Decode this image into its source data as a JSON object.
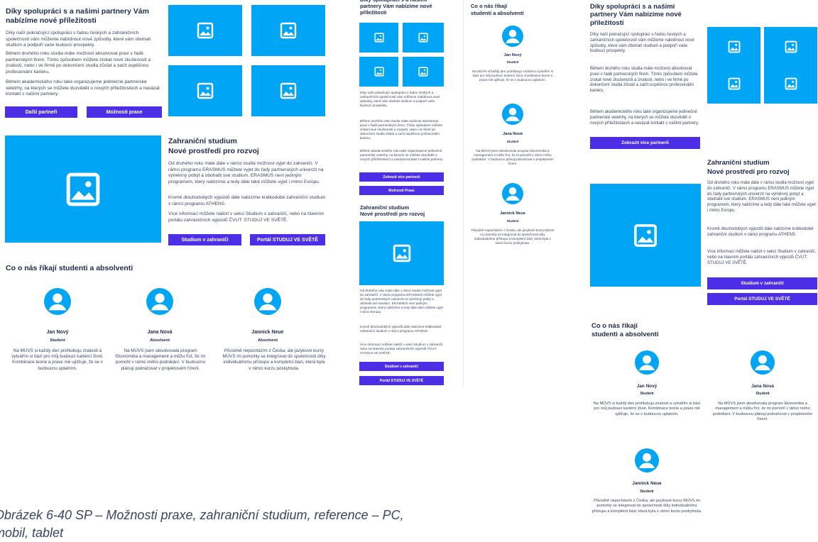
{
  "partners": {
    "title": "Díky spolupráci s a našimi partnery Vám nabízíme nové příležitosti",
    "p1": "Díky naší pokračující spolupráci s řadou českých a zahraničních společností vám můžeme nabídnout nové způsoby, které vám obohatí studium a podpoří vaše budoucí prospekty.",
    "p2": "Během druhého roku studia máte možnost absolvovat praxi v řadě partnerských firem. Tímto způsobem můžete získat nové zkušenosti a znalosti, nebo i ve firmě po dokončení studia zůstat a začít úspěšnou profesionální kariéru.",
    "p3": "Během akademického roku také organizujeme jedinečné partnerské veletrhy, na kterých se můžete dozvědět o nových příležitostech a navázat kontakt s našimi partnery.",
    "btn_partners": "Další partneři",
    "btn_practice": "Možnosti praxe",
    "btn_more_partners": "Zobrazit více partnerů",
    "btn_practice_mobile": "Možnosti Praxe"
  },
  "abroad": {
    "title_line1": "Zahraniční studium",
    "title_line2": "Nové prostředí pro rozvoj",
    "p1": "Od druhého roku máte dále v rámci studia možnost vyjet do zahraničí. V rámci programu ERASMUS můžete vyjet do řady partnerských univerzit na výměnný pobyt a obohatit své studium. ERASMUS není jediným programem, který nabízíme a tedy dále také můžete vyjet i mimo Evropu.",
    "p2": "Kromě dlouhodobých výjezdů dále nabízíme krátkodobé zahraniční studium v rámci programu ATHENS.",
    "p3": "Více informací můžete nalézt v sekci Studium v zahraničí, nebo na hlavním portálu zahraničních výjezdů ČVUT: STUDUJ VE SVĚTĚ.",
    "btn_abroad": "Studium v zahraničí",
    "btn_portal": "Portál STUDUJ VE SVĚTĚ"
  },
  "testimonials": {
    "title": "Co o nás říkají studenti a absolventi",
    "title_line1": "Co o nás říkají",
    "title_line2": "studenti a absolventi",
    "people": [
      {
        "name": "Jan Nový",
        "role": "Student",
        "quote": "Na MÚVS si každý den prohlubuju znalosti a vytvářím si bázi pro můj budoucí kariérní život. Kombinace teorie a praxe mě ujišťuje, že se v budoucnu uplatním."
      },
      {
        "name": "Jana Nová",
        "role_desktop": "Absolvent",
        "role": "Student",
        "quote": "Na MÚVS jsem absolvovala program Ekonomika a management a můžu říct, že mi pomohl v rámci mého podnikání. V budoucnu plánuji pokračovat v projektovém řízení."
      },
      {
        "name": "Jannick Neue",
        "role_desktop": "Absolvent",
        "role": "Student",
        "quote": "Původně nepocházím z Česka, ale jazykové kurzy MÚVS mi pomohly se integrovat do společnosti díky individuálnímu přístupu a kompletní bázi, která byla v rámci kurzu poskytnuta."
      }
    ]
  },
  "caption": {
    "line1": "Obrázek 6-40 SP – Možnosti praxe, zahraniční studium, reference – PC,",
    "line2": "mobil, tablet"
  },
  "colors": {
    "primary": "#4b2ee6",
    "image": "#00a6f5",
    "text": "#1e2a4a"
  },
  "icons": [
    "image-placeholder-icon",
    "user-avatar-icon"
  ]
}
